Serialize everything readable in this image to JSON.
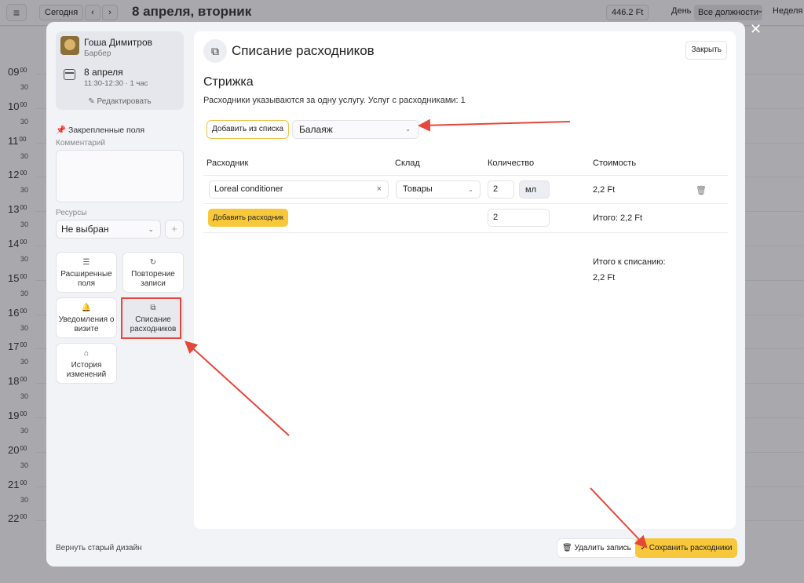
{
  "calendar": {
    "menu_icon": "hamburger-icon",
    "today_label": "Сегодня",
    "prev_icon": "chevron-left-icon",
    "next_icon": "chevron-right-icon",
    "date_title": "8 апреля, вторник",
    "balance": "446.2 Ft",
    "view_day": "День",
    "view_positions": "Все должности",
    "view_week": "Неделя",
    "hours": [
      {
        "h": "09",
        "m": "00"
      },
      {
        "h": "10",
        "m": "00"
      },
      {
        "h": "11",
        "m": "00"
      },
      {
        "h": "12",
        "m": "00"
      },
      {
        "h": "13",
        "m": "00"
      },
      {
        "h": "14",
        "m": "00"
      },
      {
        "h": "15",
        "m": "00"
      },
      {
        "h": "16",
        "m": "00"
      },
      {
        "h": "17",
        "m": "00"
      },
      {
        "h": "18",
        "m": "00"
      },
      {
        "h": "19",
        "m": "00"
      },
      {
        "h": "20",
        "m": "00"
      },
      {
        "h": "21",
        "m": "00"
      },
      {
        "h": "22",
        "m": "00"
      }
    ],
    "half_label": "30"
  },
  "modal": {
    "close_icon": "close-icon",
    "profile": {
      "name": "Гоша Димитров",
      "role": "Барбер",
      "date": "8 апреля",
      "time": "11:30-12:30 · 1 час",
      "edit_label": "✎ Редактировать"
    },
    "pinned_label": "Закрепленные поля",
    "comment_label": "Комментарий",
    "resources_label": "Ресурсы",
    "resources_value": "Не выбран",
    "tiles": [
      {
        "label": "Расширенные поля",
        "icon": "list-icon",
        "glyph": "☰"
      },
      {
        "label": "Повторение записи",
        "icon": "repeat-icon",
        "glyph": "↻"
      },
      {
        "label": "Уведомления о визите",
        "icon": "bell-icon",
        "glyph": "🔔"
      },
      {
        "label": "Списание расходников",
        "icon": "box-icon",
        "glyph": "⧉"
      },
      {
        "label": "История изменений",
        "icon": "history-icon",
        "glyph": "⌂"
      }
    ],
    "old_design_label": "Вернуть старый дизайн",
    "panel": {
      "title": "Списание расходников",
      "close_label": "Закрыть",
      "service_name": "Стрижка",
      "hint": "Расходники указываются за одну услугу. Услуг с расходниками: 1",
      "add_from_list_label": "Добавить из списка",
      "service_select_value": "Балаяж",
      "columns": [
        "Расходник",
        "Склад",
        "Количество",
        "Стоимость"
      ],
      "rows": [
        {
          "consumable": "Loreal conditioner",
          "warehouse": "Товары",
          "quantity": "2",
          "unit": "мл",
          "cost": "2,2 Ft"
        }
      ],
      "add_consumable_label": "Добавить расходник",
      "total_quantity": "2",
      "subtotal": "Итого: 2,2 Ft",
      "writeoff_label": "Итого к списанию:",
      "writeoff_value": "2,2 Ft"
    },
    "delete_label": "🗑 Удалить запись",
    "save_label": "✓ Сохранить расходники"
  },
  "annotation_color": "#e5473a",
  "accent_color": "#f7c83c"
}
